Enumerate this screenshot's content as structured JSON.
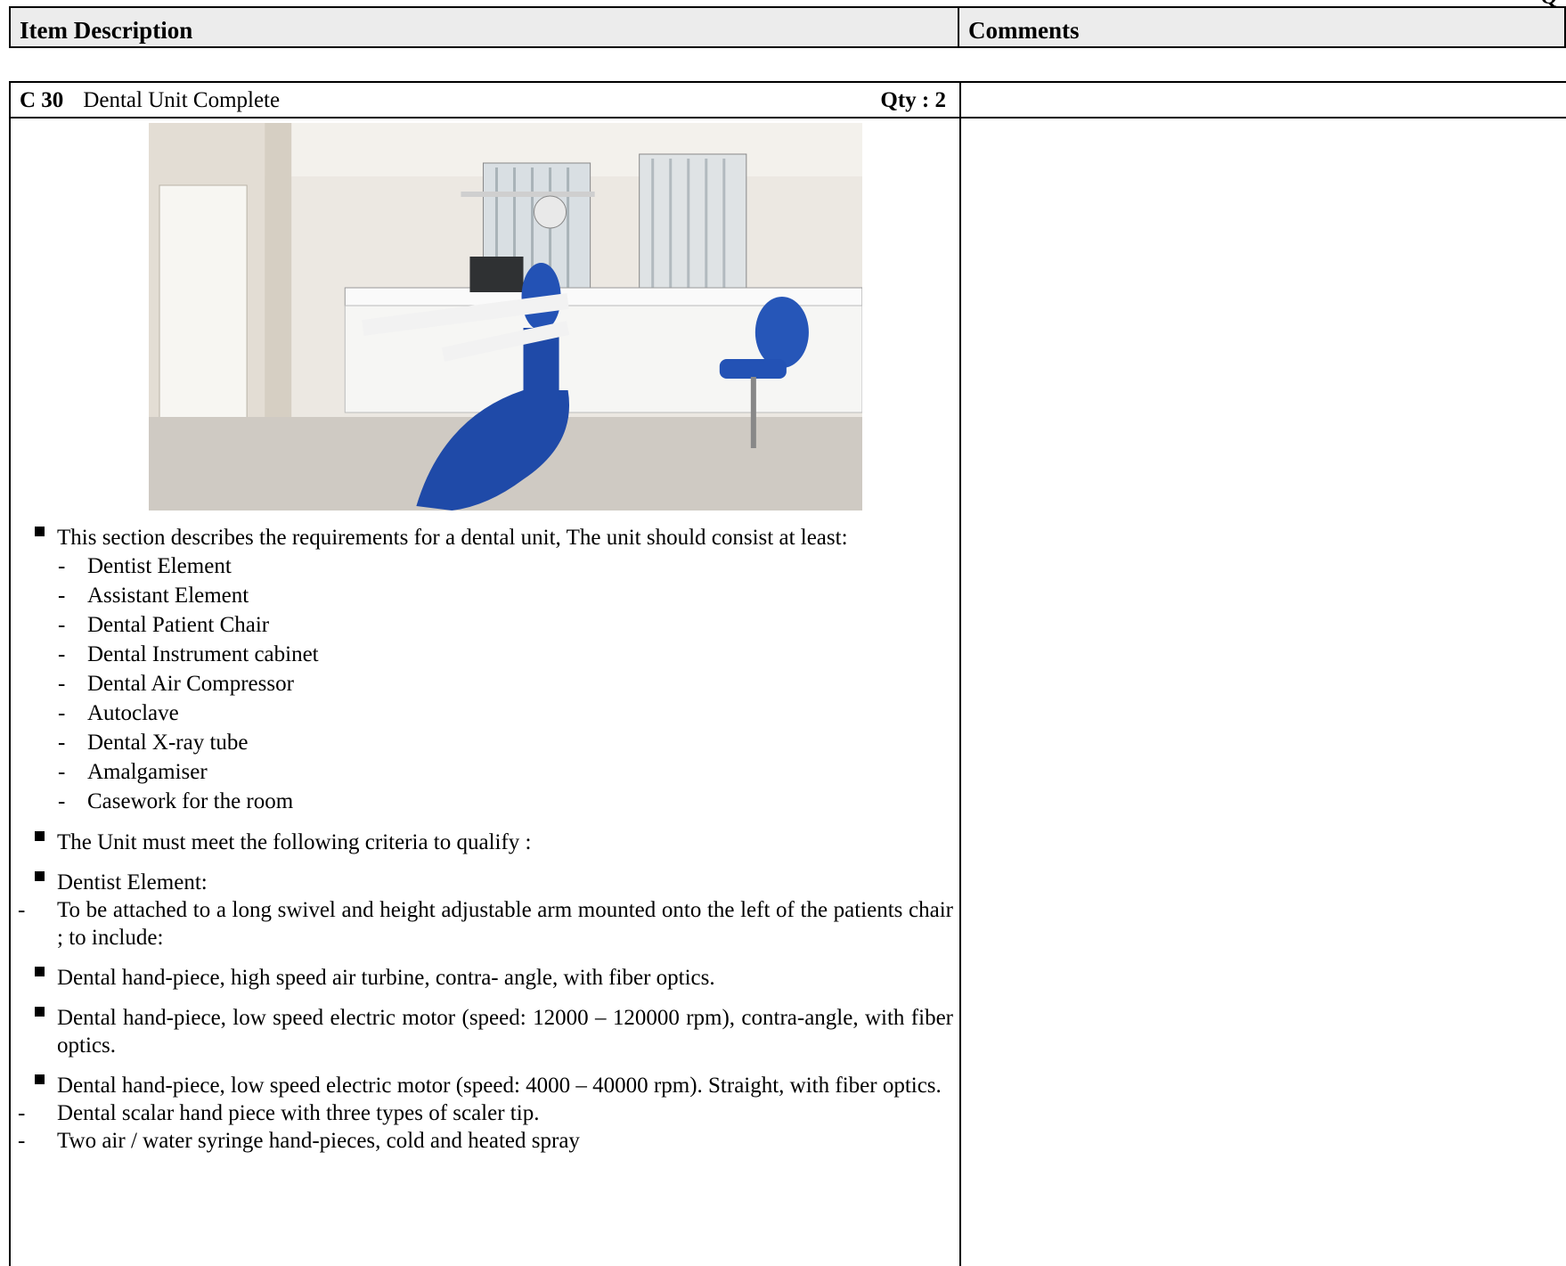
{
  "header": {
    "item_col": "Item Description",
    "comments_col": "Comments",
    "top_peek": "Q"
  },
  "item": {
    "code": "C 30",
    "name": "Dental Unit Complete",
    "qty": "Qty : 2"
  },
  "photo_icon": "dental-room-photo",
  "intro": "This section describes the requirements for a dental unit, The unit should consist at least:",
  "components": [
    "Dentist  Element",
    "Assistant Element",
    "Dental Patient Chair",
    "Dental Instrument cabinet",
    "Dental Air Compressor",
    "Autoclave",
    "Dental X-ray tube",
    "Amalgamiser",
    "Casework for the room"
  ],
  "criteria": "The Unit must meet the following criteria to qualify :",
  "dentist_element": "Dentist Element:",
  "arm_note": "To be attached to a long swivel and height adjustable arm mounted onto the left of the patients chair ; to include:",
  "handpiece_1": "Dental hand-piece, high speed air turbine, contra- angle, with fiber optics.",
  "handpiece_2": "Dental hand-piece, low speed electric motor (speed: 12000 – 120000 rpm), contra-angle, with fiber optics.",
  "handpiece_3": "Dental hand-piece, low speed electric motor (speed: 4000 – 40000 rpm). Straight, with fiber optics.",
  "scaler": "Dental scalar hand piece with three types of scaler tip.",
  "syringe": "Two air / water syringe hand-pieces, cold and heated spray"
}
